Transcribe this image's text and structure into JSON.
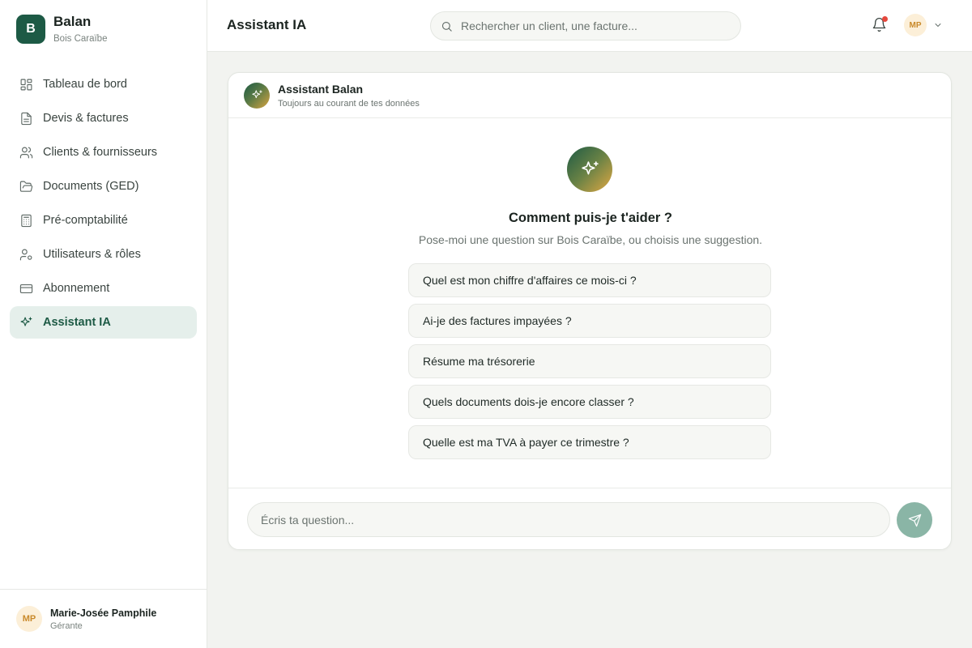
{
  "brand": {
    "initial": "B",
    "name": "Balan",
    "subtitle": "Bois Caraïbe",
    "color": "#1d5a45"
  },
  "sidebar": {
    "items": [
      {
        "label": "Tableau de bord",
        "icon": "dashboard-icon",
        "active": false
      },
      {
        "label": "Devis & factures",
        "icon": "file-text-icon",
        "active": false
      },
      {
        "label": "Clients & fournisseurs",
        "icon": "users-icon",
        "active": false
      },
      {
        "label": "Documents (GED)",
        "icon": "folder-open-icon",
        "active": false
      },
      {
        "label": "Pré-comptabilité",
        "icon": "calculator-icon",
        "active": false
      },
      {
        "label": "Utilisateurs & rôles",
        "icon": "user-cog-icon",
        "active": false
      },
      {
        "label": "Abonnement",
        "icon": "credit-card-icon",
        "active": false
      },
      {
        "label": "Assistant IA",
        "icon": "sparkles-icon",
        "active": true
      }
    ]
  },
  "user": {
    "initials": "MP",
    "name": "Marie-Josée Pamphile",
    "role": "Gérante"
  },
  "header": {
    "title": "Assistant IA",
    "search_placeholder": "Rechercher un client, une facture...",
    "notification_dot": true,
    "avatar_initials": "MP"
  },
  "chat": {
    "title": "Assistant Balan",
    "subtitle": "Toujours au courant de tes données",
    "welcome_title": "Comment puis-je t'aider ?",
    "welcome_subtitle": "Pose-moi une question sur Bois Caraïbe, ou choisis une suggestion.",
    "suggestions": [
      "Quel est mon chiffre d'affaires ce mois-ci ?",
      "Ai-je des factures impayées ?",
      "Résume ma trésorerie",
      "Quels documents dois-je encore classer ?",
      "Quelle est ma TVA à payer ce trimestre ?"
    ],
    "input_placeholder": "Écris ta question...",
    "input_value": ""
  },
  "colors": {
    "accent": "#1d5a45",
    "active_bg": "#e5efeb",
    "send_button": "#8ab5a6",
    "notification": "#e5483d",
    "avatar_bg": "#fcefd8"
  }
}
